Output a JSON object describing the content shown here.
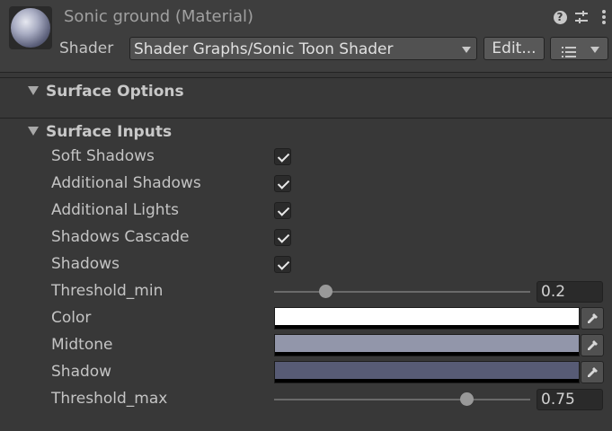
{
  "header": {
    "title": "Sonic ground (Material)",
    "help_icon": "?",
    "shader_label": "Shader",
    "shader_value": "Shader Graphs/Sonic Toon Shader",
    "edit_label": "Edit..."
  },
  "sections": {
    "surface_options": "Surface Options",
    "surface_inputs": "Surface Inputs"
  },
  "inputs": {
    "soft_shadows": {
      "label": "Soft Shadows",
      "checked": true
    },
    "additional_shadows": {
      "label": "Additional Shadows",
      "checked": true
    },
    "additional_lights": {
      "label": "Additional Lights",
      "checked": true
    },
    "shadows_cascade": {
      "label": "Shadows Cascade",
      "checked": true
    },
    "shadows": {
      "label": "Shadows",
      "checked": true
    },
    "threshold_min": {
      "label": "Threshold_min",
      "value": "0.2",
      "fraction": 0.2
    },
    "color": {
      "label": "Color",
      "swatch": "#ffffff"
    },
    "midtone": {
      "label": "Midtone",
      "swatch": "#9296aa"
    },
    "shadow": {
      "label": "Shadow",
      "swatch": "#575b75"
    },
    "threshold_max": {
      "label": "Threshold_max",
      "value": "0.75",
      "fraction": 0.75
    }
  },
  "icons": {
    "material": "sphere-icon",
    "help": "help-icon",
    "presets": "presets-icon",
    "menu": "kebab-menu-icon",
    "eyedropper": "eyedropper-icon"
  }
}
